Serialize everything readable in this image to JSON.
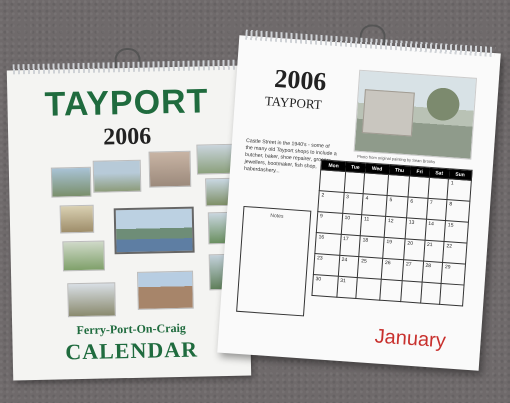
{
  "left_calendar": {
    "title": "TAYPORT",
    "year": "2006",
    "subtitle": "Ferry-Port-On-Craig",
    "label": "CALENDAR"
  },
  "right_calendar": {
    "year": "2006",
    "place": "TAYPORT",
    "photo_caption": "Photo from original painting by Sean Brooks",
    "description": "Castle Street in the 1940's - some of the many old Tayport shops to include a butcher, baker, shoe repairer, grocers, jewellers, bootmaker, fish shop, haberdashery...",
    "notes_label": "Notes",
    "weekdays": [
      "Mon",
      "Tue",
      "Wed",
      "Thu",
      "Fri",
      "Sat",
      "Sun"
    ],
    "weeks": [
      [
        "",
        "",
        "",
        "",
        "",
        "",
        "1"
      ],
      [
        "2",
        "3",
        "4",
        "5",
        "6",
        "7",
        "8"
      ],
      [
        "9",
        "10",
        "11",
        "12",
        "13",
        "14",
        "15"
      ],
      [
        "16",
        "17",
        "18",
        "19",
        "20",
        "21",
        "22"
      ],
      [
        "23",
        "24",
        "25",
        "26",
        "27",
        "28",
        "29"
      ],
      [
        "30",
        "31",
        "",
        "",
        "",
        "",
        ""
      ]
    ],
    "month": "January"
  },
  "colors": {
    "green": "#1f6b3e",
    "red": "#c8302d",
    "background": "#6f6a6b"
  }
}
